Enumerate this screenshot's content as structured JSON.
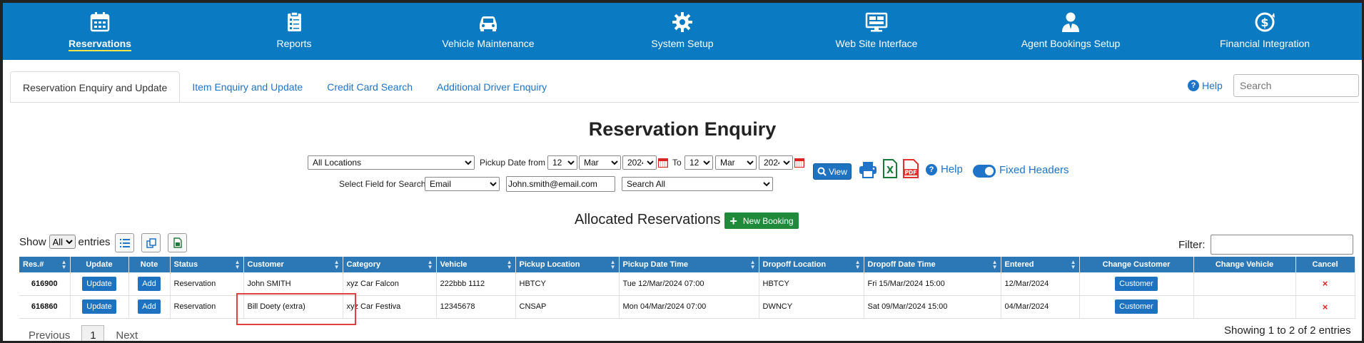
{
  "nav": {
    "items": [
      {
        "label": "Reservations",
        "icon": "calendar-icon",
        "active": true
      },
      {
        "label": "Reports",
        "icon": "clipboard-icon"
      },
      {
        "label": "Vehicle Maintenance",
        "icon": "car-icon"
      },
      {
        "label": "System Setup",
        "icon": "gear-icon"
      },
      {
        "label": "Web Site Interface",
        "icon": "monitor-icon"
      },
      {
        "label": "Agent Bookings Setup",
        "icon": "agent-icon"
      },
      {
        "label": "Financial Integration",
        "icon": "dollar-cycle-icon"
      }
    ]
  },
  "tabs": [
    {
      "label": "Reservation Enquiry and Update",
      "active": true
    },
    {
      "label": "Item Enquiry and Update"
    },
    {
      "label": "Credit Card Search"
    },
    {
      "label": "Additional Driver Enquiry"
    }
  ],
  "header": {
    "help_label": "Help",
    "search_placeholder": "Search"
  },
  "page_title": "Reservation Enquiry",
  "filters": {
    "location": "All Locations",
    "pickup_date_from_label": "Pickup Date from",
    "from_day": "12",
    "from_month": "Mar",
    "from_year": "2024",
    "to_label": "To",
    "to_day": "12",
    "to_month": "Mar",
    "to_year": "2024",
    "select_field_label": "Select Field for Search",
    "search_field": "Email",
    "search_value": "John.smith@email.com",
    "search_scope": "Search All",
    "view_label": "View",
    "help_label": "Help",
    "fixed_headers_label": "Fixed Headers"
  },
  "allocated": {
    "title": "Allocated Reservations",
    "new_booking_label": "New Booking"
  },
  "table_controls": {
    "show_label": "Show",
    "show_value": "All",
    "entries_label": "entries",
    "filter_label": "Filter:"
  },
  "table": {
    "columns": [
      "Res.#",
      "Update",
      "Note",
      "Status",
      "Customer",
      "Category",
      "Vehicle",
      "Pickup Location",
      "Pickup Date Time",
      "Dropoff Location",
      "Dropoff Date Time",
      "Entered",
      "Change Customer",
      "Change Vehicle",
      "Cancel"
    ],
    "update_label": "Update",
    "note_label": "Add",
    "customer_btn_label": "Customer",
    "cancel_mark": "×",
    "rows": [
      {
        "res": "616900",
        "status": "Reservation",
        "customer": "John SMITH",
        "category": "xyz Car Falcon",
        "vehicle": "222bbb 1112",
        "pickup_location": "HBTCY",
        "pickup_datetime": "Tue 12/Mar/2024 07:00",
        "dropoff_location": "HBTCY",
        "dropoff_datetime": "Fri 15/Mar/2024 15:00",
        "entered": "12/Mar/2024"
      },
      {
        "res": "616860",
        "status": "Reservation",
        "customer": "Bill Doety (extra)",
        "category": "xyz Car Festiva",
        "vehicle": "12345678",
        "pickup_location": "CNSAP",
        "pickup_datetime": "Mon 04/Mar/2024 07:00",
        "dropoff_location": "DWNCY",
        "dropoff_datetime": "Sat 09/Mar/2024 15:00",
        "entered": "04/Mar/2024"
      }
    ]
  },
  "pager": {
    "previous": "Previous",
    "page": "1",
    "next": "Next",
    "info": "Showing 1 to 2 of 2 entries"
  },
  "colors": {
    "nav_bg": "#0a7ac2",
    "header_bg": "#2c78b7",
    "link": "#1f73c8",
    "res_number": "#d31a1a",
    "new_booking": "#1f8a3a",
    "highlight": "#e04040"
  }
}
